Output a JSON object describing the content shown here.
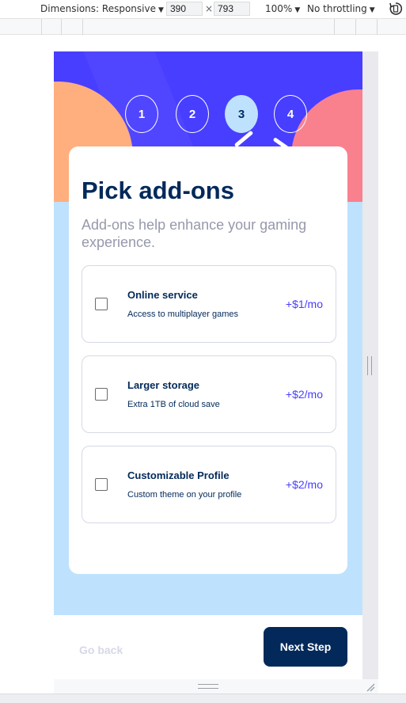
{
  "devtools": {
    "dimensions_label": "Dimensions: Responsive",
    "width_value": "390",
    "times_symbol": "×",
    "height_value": "793",
    "zoom_label": "100%",
    "throttle_label": "No throttling"
  },
  "steps": [
    "1",
    "2",
    "3",
    "4"
  ],
  "active_step": 3,
  "card": {
    "title": "Pick add-ons",
    "subtitle": "Add-ons help enhance your gaming experience."
  },
  "addons": [
    {
      "name": "Online service",
      "description": "Access to multiplayer games",
      "price": "+$1/mo",
      "checked": false
    },
    {
      "name": "Larger storage",
      "description": "Extra 1TB of cloud save",
      "price": "+$2/mo",
      "checked": false
    },
    {
      "name": "Customizable Profile",
      "description": "Custom theme on your profile",
      "price": "+$2/mo",
      "checked": false
    }
  ],
  "footer": {
    "back_label": "Go back",
    "next_label": "Next Step"
  },
  "colors": {
    "marine_blue": "#02295a",
    "purplish_blue": "#473dff",
    "light_blue": "#bee2fd",
    "cool_gray": "#9699ab",
    "light_gray": "#d6d9e6"
  }
}
